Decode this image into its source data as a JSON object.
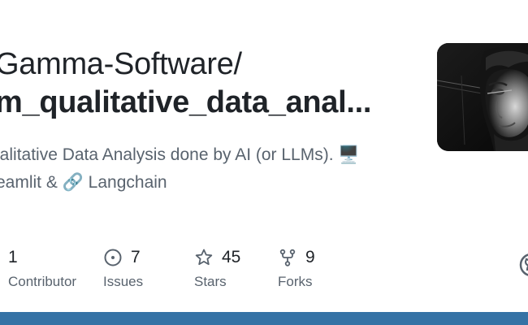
{
  "repo": {
    "owner": "Gamma-Software/",
    "name": "m_qualitative_data_anal...",
    "description_line1": "ualitative Data Analysis done by AI (or LLMs). 🖥️",
    "description_line2": "reamlit & 🔗 Langchain"
  },
  "stats": {
    "contributors": {
      "value": "1",
      "label": "Contributor",
      "icon": "people-icon"
    },
    "issues": {
      "value": "7",
      "label": "Issues",
      "icon": "issue-opened-icon"
    },
    "stars": {
      "value": "45",
      "label": "Stars",
      "icon": "star-icon"
    },
    "forks": {
      "value": "9",
      "label": "Forks",
      "icon": "repo-forked-icon"
    }
  },
  "colors": {
    "text_primary": "#1f2328",
    "text_secondary": "#59636e",
    "bottom_bar": "#3572a5"
  }
}
